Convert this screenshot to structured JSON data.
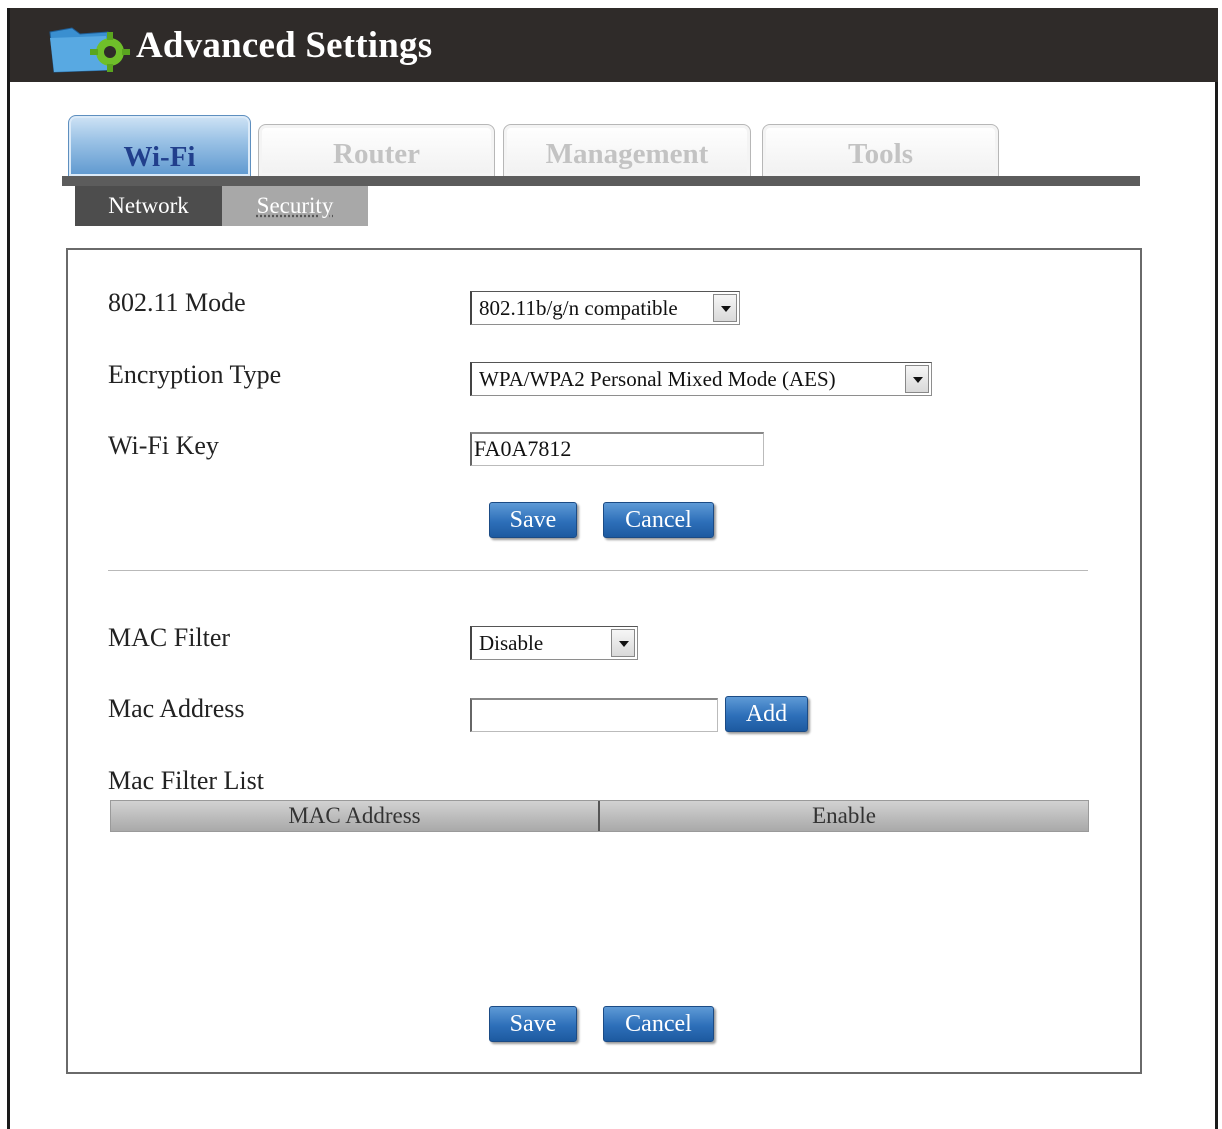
{
  "header": {
    "title": "Advanced Settings",
    "icon": "folder-gear-icon"
  },
  "tabs": [
    {
      "label": "Wi-Fi",
      "active": true
    },
    {
      "label": "Router",
      "active": false
    },
    {
      "label": "Management",
      "active": false
    },
    {
      "label": "Tools",
      "active": false
    }
  ],
  "subtabs": [
    {
      "label": "Network",
      "active": false
    },
    {
      "label": "Security",
      "active": true
    }
  ],
  "security": {
    "mode_label": "802.11 Mode",
    "mode_value": "802.11b/g/n compatible",
    "encryption_label": "Encryption Type",
    "encryption_value": "WPA/WPA2 Personal Mixed Mode (AES)",
    "key_label": "Wi-Fi Key",
    "key_value": "FA0A7812",
    "save_label": "Save",
    "cancel_label": "Cancel"
  },
  "mac_filter": {
    "filter_label": "MAC Filter",
    "filter_value": "Disable",
    "address_label": "Mac Address",
    "address_value": "",
    "add_label": "Add",
    "list_label": "Mac Filter List",
    "columns": [
      "MAC Address",
      "Enable"
    ],
    "rows": [],
    "save_label": "Save",
    "cancel_label": "Cancel"
  },
  "colors": {
    "titlebar": "#2f2b29",
    "active_tab_text": "#213f8c",
    "button": "#2d6fb9"
  }
}
